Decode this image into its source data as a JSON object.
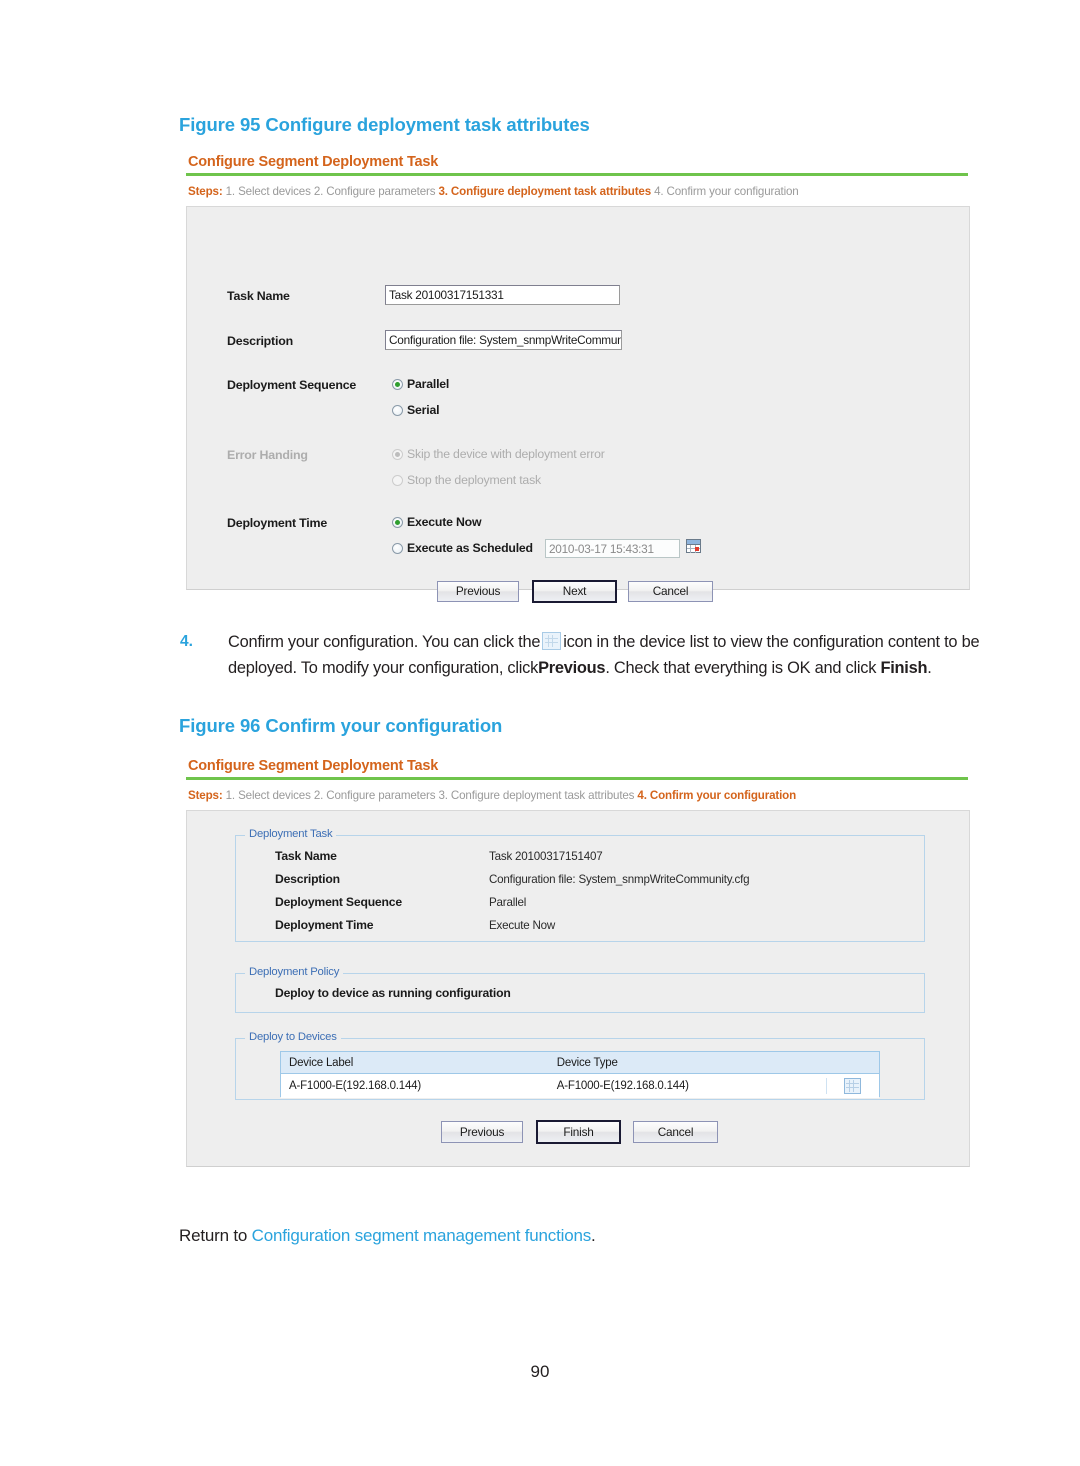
{
  "page": {
    "number": "90"
  },
  "figure95": {
    "caption": "Figure 95 Configure deployment task attributes",
    "screenshot": {
      "title": "Configure Segment Deployment Task",
      "steps_label": "Steps:",
      "steps": [
        {
          "text": "1. Select devices",
          "state": "done"
        },
        {
          "text": "2. Configure parameters",
          "state": "done"
        },
        {
          "text": "3. Configure deployment task attributes",
          "state": "current"
        },
        {
          "text": "4. Confirm your configuration",
          "state": "pending"
        }
      ],
      "fields": {
        "task_name_label": "Task Name",
        "task_name_value": "Task 20100317151331",
        "description_label": "Description",
        "description_value": "Configuration file: System_snmpWriteCommunit",
        "deployment_sequence_label": "Deployment Sequence",
        "deployment_sequence_options": [
          {
            "label": "Parallel",
            "selected": true
          },
          {
            "label": "Serial",
            "selected": false
          }
        ],
        "error_handling_label": "Error Handing",
        "error_handling_options": [
          {
            "label": "Skip the device with deployment error",
            "selected": true
          },
          {
            "label": "Stop the deployment task",
            "selected": false
          }
        ],
        "deployment_time_label": "Deployment Time",
        "deployment_time_options": [
          {
            "label": "Execute Now",
            "selected": true
          },
          {
            "label": "Execute as Scheduled",
            "selected": false
          }
        ],
        "scheduled_value": "2010-03-17 15:43:31",
        "calendar_icon": "calendar-icon"
      },
      "buttons": {
        "previous": "Previous",
        "next": "Next",
        "cancel": "Cancel"
      }
    }
  },
  "step4": {
    "number": "4.",
    "line1_a": "Confirm your configuration. You can click the",
    "inline_icon": "config-content-icon",
    "line1_b": "icon in the device list to view the configuration",
    "line2_a": "content to be deployed. To modify your configuration, click",
    "line2_bold": "Previous",
    "line2_b": ". Check that everything is OK",
    "line3_a": "and click",
    "line3_bold": "Finish",
    "line3_b": "."
  },
  "figure96": {
    "caption": "Figure 96 Confirm your configuration",
    "screenshot": {
      "title": "Configure Segment Deployment Task",
      "steps_label": "Steps:",
      "steps": [
        {
          "text": "1. Select devices",
          "state": "done"
        },
        {
          "text": "2. Configure parameters",
          "state": "done"
        },
        {
          "text": "3. Configure deployment task attributes",
          "state": "done"
        },
        {
          "text": "4. Confirm your configuration",
          "state": "current"
        }
      ],
      "deployment_task": {
        "legend": "Deployment Task",
        "rows": [
          {
            "label": "Task Name",
            "value": "Task 20100317151407"
          },
          {
            "label": "Description",
            "value": "Configuration file: System_snmpWriteCommunity.cfg"
          },
          {
            "label": "Deployment Sequence",
            "value": "Parallel"
          },
          {
            "label": "Deployment Time",
            "value": "Execute Now"
          }
        ]
      },
      "deployment_policy": {
        "legend": "Deployment Policy",
        "text": "Deploy to device as running configuration"
      },
      "deploy_to_devices": {
        "legend": "Deploy to Devices",
        "columns": [
          "Device Label",
          "Device Type",
          ""
        ],
        "rows": [
          {
            "device_label": "A-F1000-E(192.168.0.144)",
            "device_type": "A-F1000-E(192.168.0.144)",
            "action_icon": "config-content-icon"
          }
        ]
      },
      "buttons": {
        "previous": "Previous",
        "finish": "Finish",
        "cancel": "Cancel"
      }
    }
  },
  "return_line": {
    "prefix": "Return to ",
    "link": "Configuration segment management functions",
    "suffix": "."
  },
  "colors": {
    "caption_blue": "#2aa3dd",
    "title_orange": "#d4641c",
    "rule_green": "#6fc44c",
    "panel_grey": "#eeeeee",
    "legend_blue": "#3d6fb5",
    "table_header_blue": "#dceaf7"
  }
}
